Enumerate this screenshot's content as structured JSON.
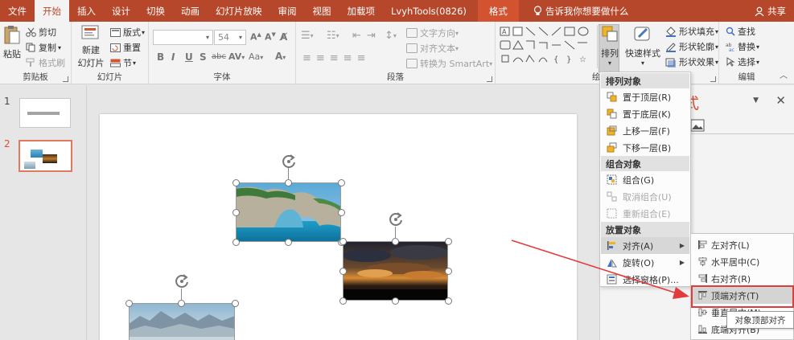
{
  "tabs": [
    "文件",
    "开始",
    "插入",
    "设计",
    "切换",
    "动画",
    "幻灯片放映",
    "审阅",
    "视图",
    "加载项",
    "LvyhTools(0826)",
    "格式"
  ],
  "active_tab": "开始",
  "tell_me": "告诉我你想要做什么",
  "share": "共享",
  "clipboard": {
    "label": "剪贴板",
    "paste": "粘贴",
    "cut": "剪切",
    "copy": "复制",
    "painter": "格式刷"
  },
  "slides_group": {
    "label": "幻灯片",
    "new_slide": "新建",
    "new_slide2": "幻灯片",
    "layout": "版式",
    "reset": "重置",
    "section": "节"
  },
  "font_group": {
    "label": "字体",
    "size": "54",
    "bold": "B",
    "italic": "I",
    "underline": "U",
    "shadow": "S",
    "strike": "abc",
    "spacing": "AV",
    "case": "Aa",
    "color": "A"
  },
  "paragraph_group": {
    "label": "段落",
    "text_direction": "文字方向",
    "align_text": "对齐文本",
    "smartart": "转换为 SmartArt"
  },
  "drawing_group": {
    "label": "绘",
    "arrange": "排列",
    "quick_styles": "快速样式",
    "fill": "形状填充",
    "outline": "形状轮廓",
    "effects": "形状效果"
  },
  "editing_group": {
    "label": "编辑",
    "find": "查找",
    "replace": "替换",
    "select": "选择"
  },
  "thumbnails": [
    "1",
    "2"
  ],
  "pane": {
    "title": "式"
  },
  "arrange_menu": {
    "sections": [
      "排列对象",
      "组合对象",
      "放置对象"
    ],
    "order_items": [
      "置于顶层(R)",
      "置于底层(K)",
      "上移一层(F)",
      "下移一层(B)"
    ],
    "group_items": [
      "组合(G)",
      "取消组合(U)",
      "重新组合(E)"
    ],
    "position_items": [
      "对齐(A)",
      "旋转(O)",
      "选择窗格(P)..."
    ]
  },
  "align_menu": {
    "items": [
      "左对齐(L)",
      "水平居中(C)",
      "右对齐(R)",
      "顶端对齐(T)",
      "垂直居中(M)",
      "底端对齐(B)"
    ]
  },
  "tooltip": "对象顶部对齐"
}
